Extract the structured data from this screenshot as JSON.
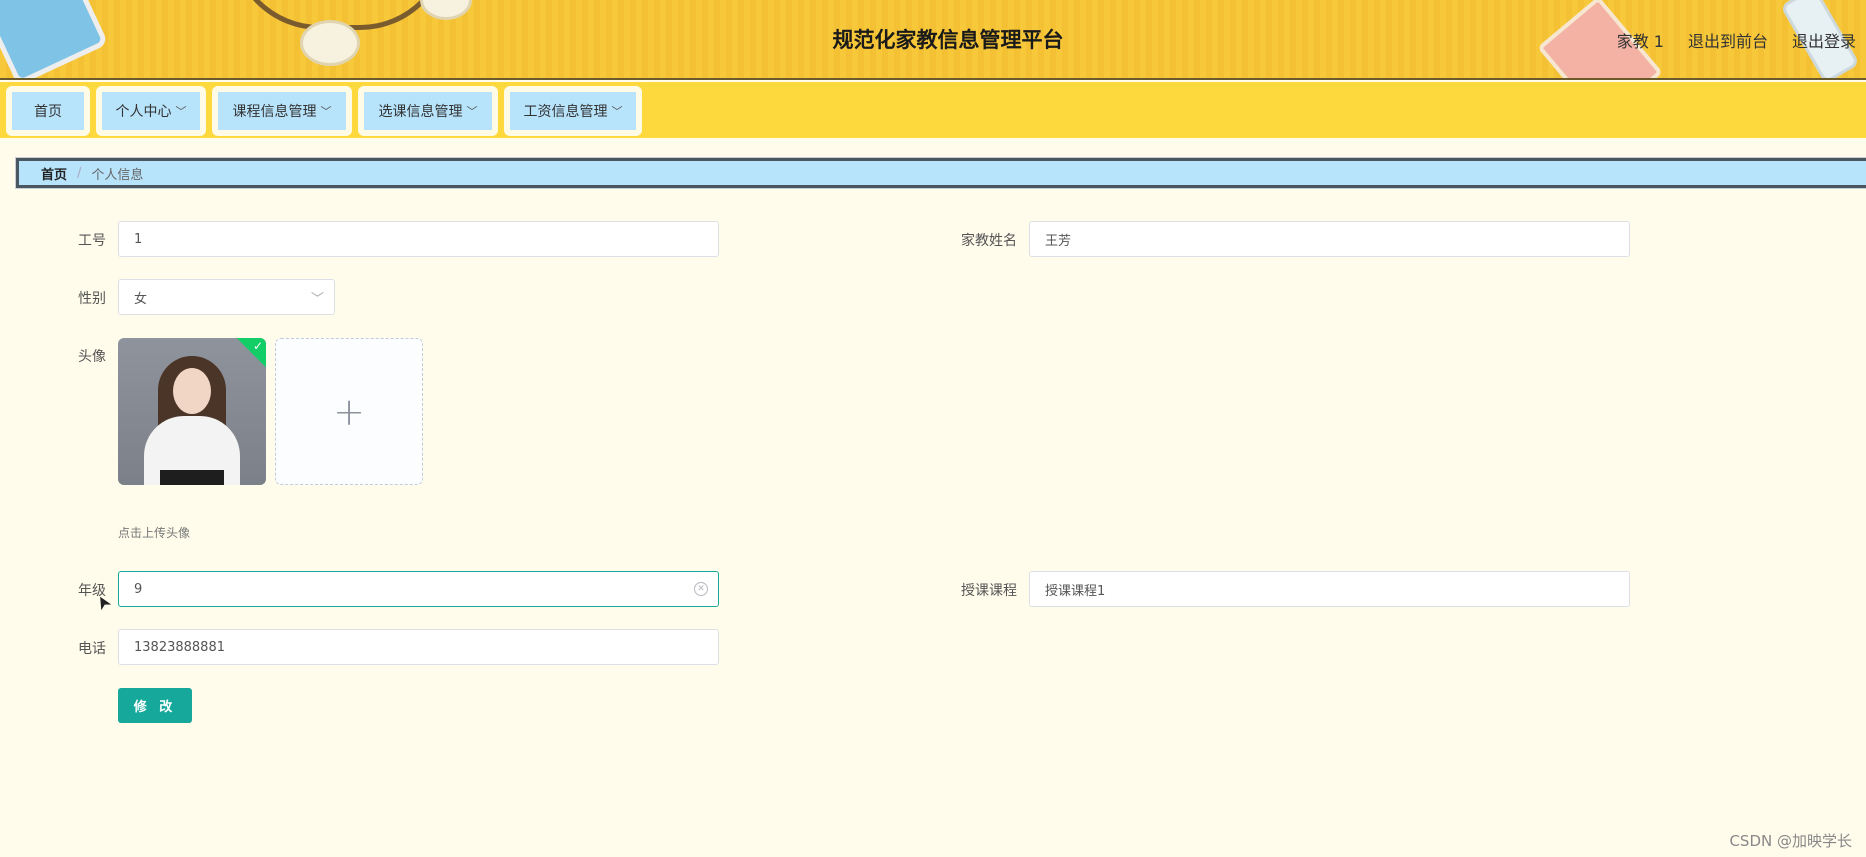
{
  "header": {
    "title": "规范化家教信息管理平台",
    "links": [
      "家教 1",
      "退出到前台",
      "退出登录"
    ]
  },
  "nav": {
    "items": [
      {
        "label": "首页",
        "has_dropdown": false
      },
      {
        "label": "个人中心",
        "has_dropdown": true
      },
      {
        "label": "课程信息管理",
        "has_dropdown": true
      },
      {
        "label": "选课信息管理",
        "has_dropdown": true
      },
      {
        "label": "工资信息管理",
        "has_dropdown": true
      }
    ]
  },
  "breadcrumb": {
    "home": "首页",
    "current": "个人信息",
    "separator": "/"
  },
  "form": {
    "employee_id": {
      "label": "工号",
      "value": "1"
    },
    "tutor_name": {
      "label": "家教姓名",
      "value": "王芳"
    },
    "gender": {
      "label": "性别",
      "value": "女"
    },
    "avatar": {
      "label": "头像",
      "hint": "点击上传头像",
      "upload_symbol": "+"
    },
    "grade": {
      "label": "年级",
      "value": "9"
    },
    "course": {
      "label": "授课课程",
      "value": "授课课程1"
    },
    "phone": {
      "label": "电话",
      "value": "13823888881"
    },
    "submit_label": "修 改"
  },
  "watermark": "CSDN @加映学长",
  "colors": {
    "header_bg": "#f7c93a",
    "nav_bg": "#fed93e",
    "nav_item_bg": "#b7e3fb",
    "page_bg": "#fffcec",
    "accent": "#15a89b"
  }
}
